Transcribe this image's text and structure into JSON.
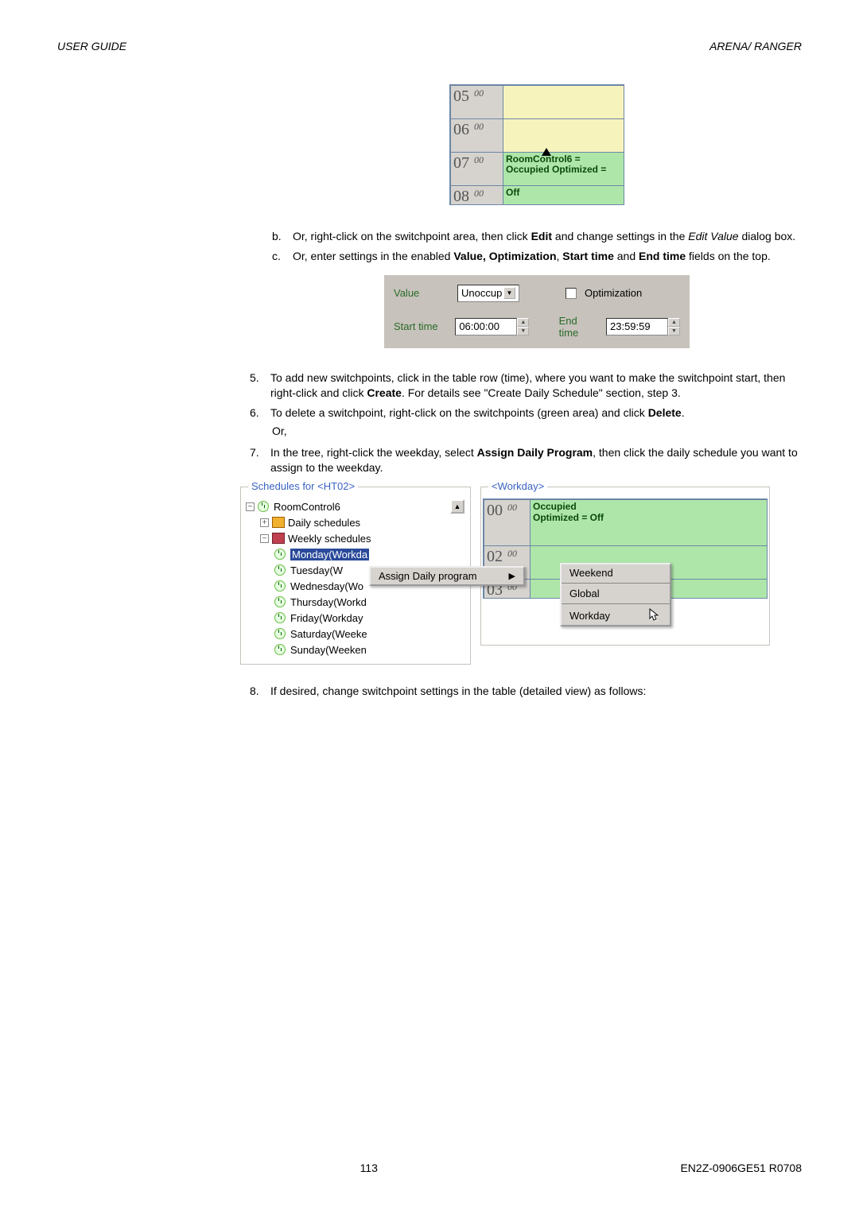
{
  "header": {
    "left": "USER GUIDE",
    "right": "ARENA/ RANGER"
  },
  "fig1": {
    "rows": [
      {
        "hour": "05",
        "min": "00",
        "cls": "yellow",
        "text": ""
      },
      {
        "hour": "06",
        "min": "00",
        "cls": "yellow",
        "text": ""
      },
      {
        "hour": "07",
        "min": "00",
        "cls": "green",
        "text": "RoomControl6 = Occupied Optimized =",
        "cursor": true
      },
      {
        "hour": "08",
        "min": "00",
        "cls": "green",
        "text": "Off",
        "short": true
      }
    ]
  },
  "step_b_pre": "Or,  right-click on the switchpoint area, then click ",
  "step_b_bold": "Edit",
  "step_b_post": " and change settings in the ",
  "step_b_ital": "Edit Value",
  "step_b_end": " dialog box.",
  "step_c_pre": "Or, enter settings in the enabled ",
  "step_c_bold1": "Value, Optimization",
  "step_c_mid": ", ",
  "step_c_bold2": "Start time",
  "step_c_and": " and ",
  "step_c_bold3": "End time",
  "step_c_end": " fields on the top.",
  "fig2": {
    "value_label": "Value",
    "value_sel": "Unoccup",
    "opt_label": "Optimization",
    "start_label": "Start time",
    "start_val": "06:00:00",
    "end_label": "End time",
    "end_val": "23:59:59"
  },
  "step5_pre": "To add new switchpoints, click in the table row (time), where you want to make the switchpoint start, then right-click and click ",
  "step5_bold": "Create",
  "step5_post": ". For details see \"Create Daily Schedule\" section, step 3.",
  "step6_pre": "To delete a switchpoint, right-click on the switchpoints (green area) and click ",
  "step6_bold": "Delete",
  "step6_post": ".",
  "or_text": "Or,",
  "step7_pre": "In the tree, right-click the weekday, select ",
  "step7_bold": "Assign Daily Program",
  "step7_post": ", then click the daily schedule you want to assign to the weekday.",
  "fig3": {
    "left_title": "Schedules for  <HT02>",
    "right_title": "<Workday>",
    "tree": {
      "root": "RoomControl6",
      "daily": "Daily schedules",
      "weekly": "Weekly schedules",
      "days": [
        "Monday(Workda",
        "Tuesday(W",
        "Wednesday(Wo",
        "Thursday(Workd",
        "Friday(Workday",
        "Saturday(Weeke",
        "Sunday(Weeken"
      ]
    },
    "wk": {
      "row0": {
        "h": "00",
        "m": "00",
        "text": "Occupied\nOptimized = Off",
        "cls": "green"
      },
      "row2": {
        "h": "02",
        "m": "00",
        "text": "",
        "cls": "green"
      },
      "row3": {
        "h": "03",
        "m": "00",
        "text": "",
        "cls": "green"
      }
    },
    "ctx": "Assign Daily program",
    "sub": [
      "Weekend",
      "Global",
      "Workday"
    ]
  },
  "step8": "If desired, change switchpoint settings in the table (detailed view) as follows:",
  "footer": {
    "page": "113",
    "doc": "EN2Z-0906GE51 R0708"
  }
}
